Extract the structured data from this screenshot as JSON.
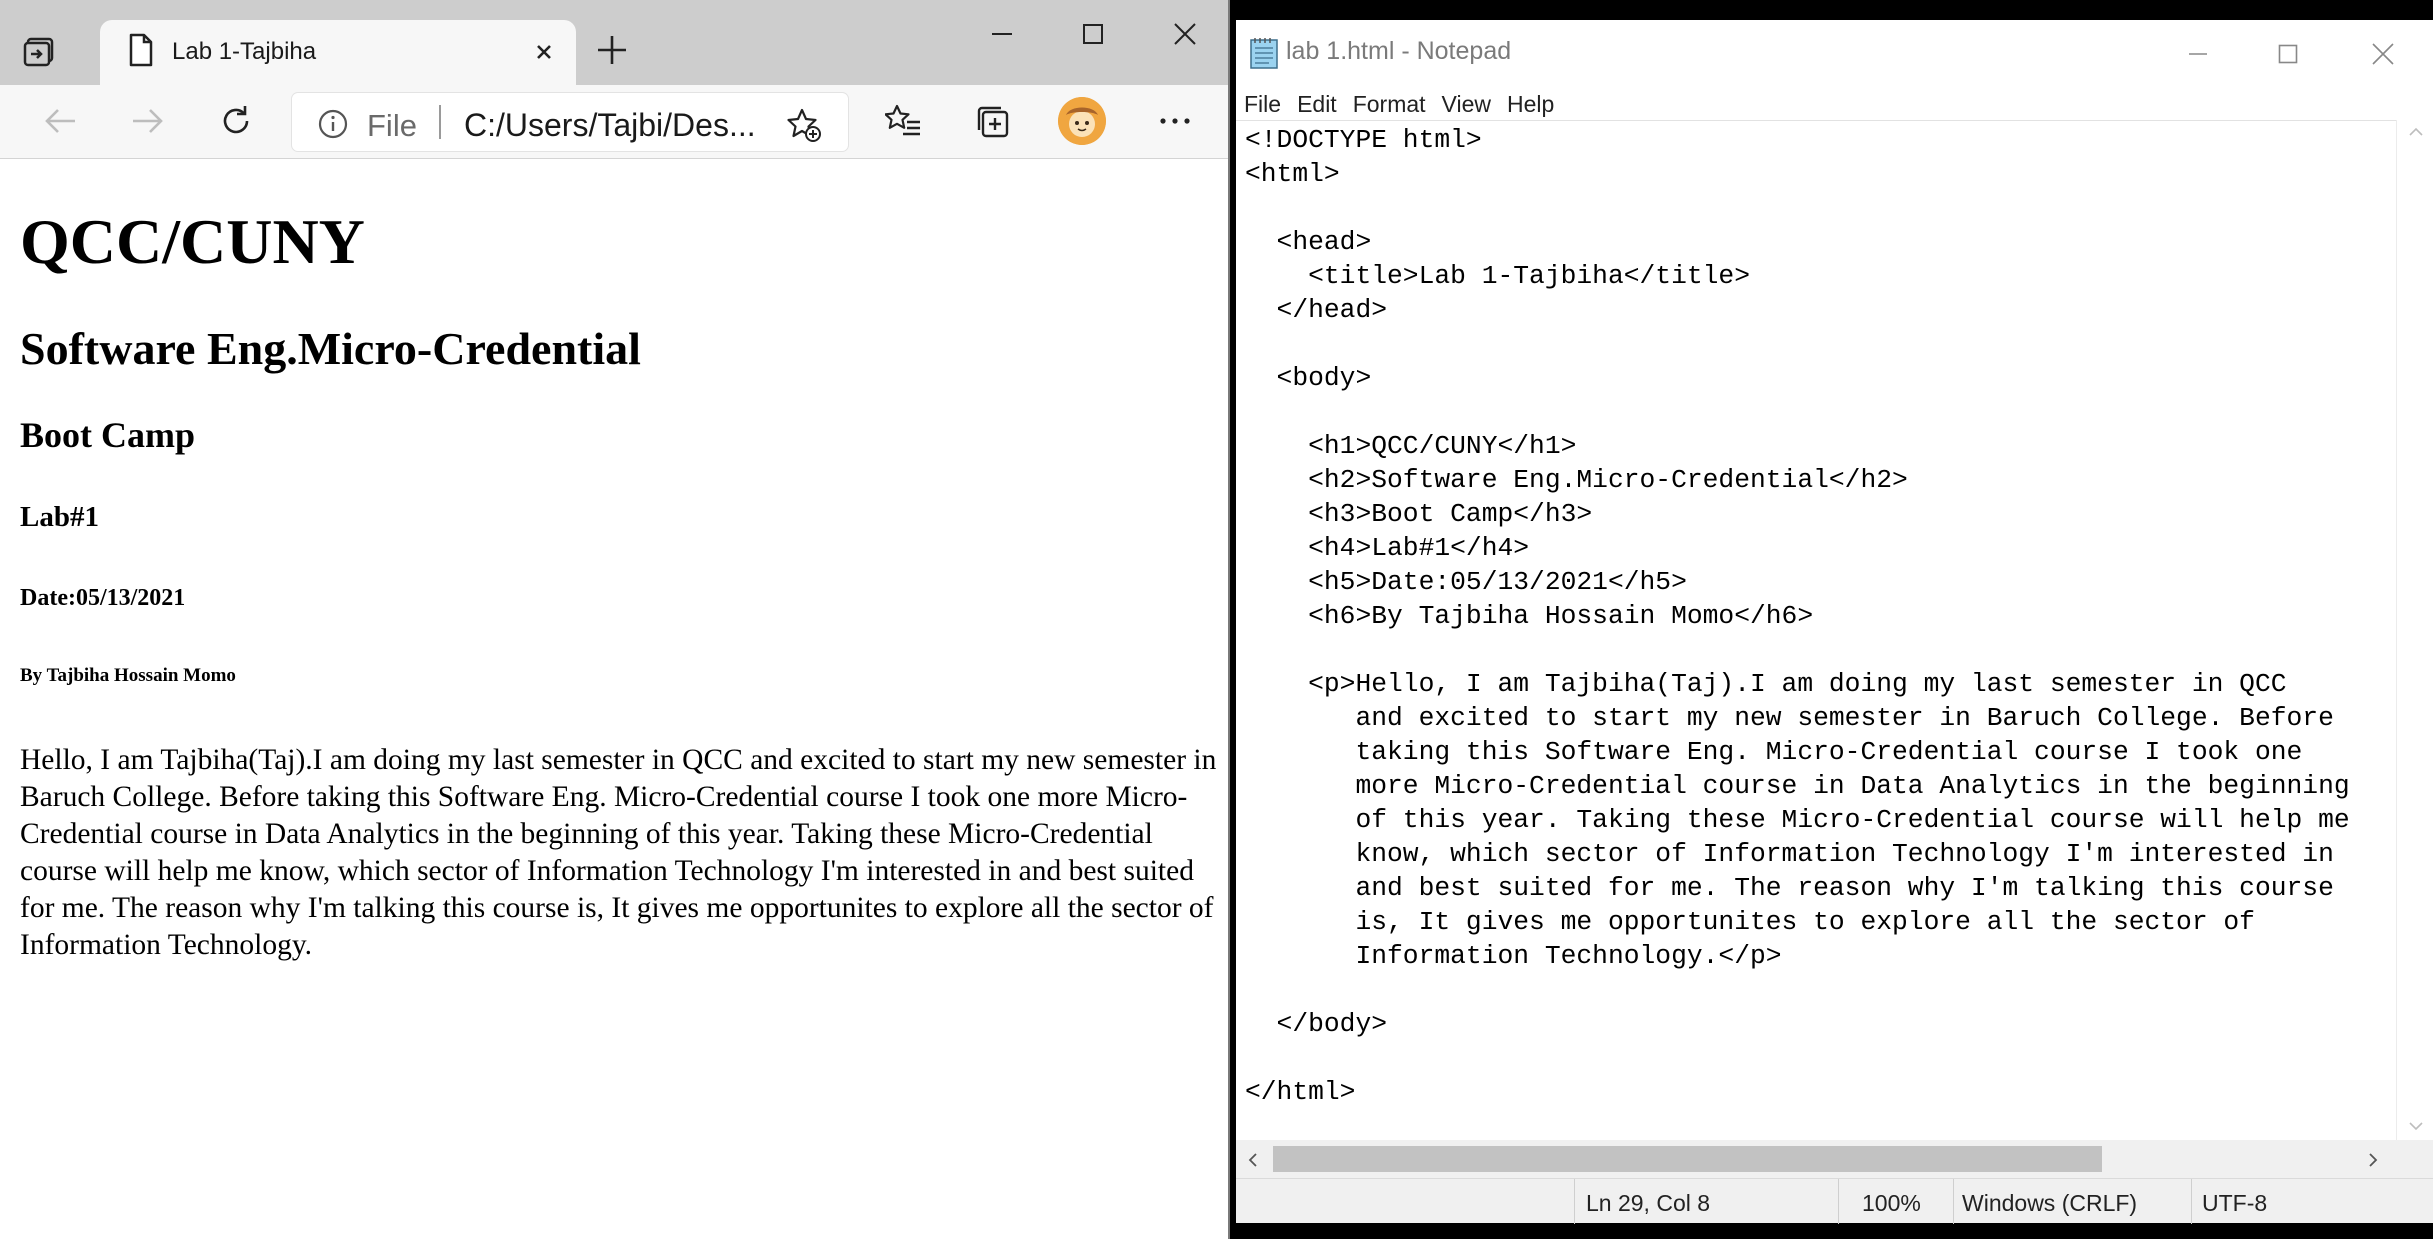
{
  "browser": {
    "tab_title": "Lab 1-Tajbiha",
    "address": {
      "scheme_label": "File",
      "url": "C:/Users/Tajbi/Des..."
    }
  },
  "document": {
    "h1": "QCC/CUNY",
    "h2": "Software Eng.Micro-Credential",
    "h3": "Boot Camp",
    "h4": "Lab#1",
    "h5": "Date:05/13/2021",
    "h6": "By Tajbiha Hossain Momo",
    "paragraph": "Hello, I am Tajbiha(Taj).I am doing my last semester in QCC and excited to start my new semester in Baruch College. Before taking this Software Eng. Micro-Credential course I took one more Micro-Credential course in Data Analytics in the beginning of this year. Taking these Micro-Credential course will help me know, which sector of Information Technology I'm interested in and best suited for me. The reason why I'm talking this course is, It gives me opportunites to explore all the sector of Information Technology."
  },
  "notepad": {
    "title": "lab 1.html - Notepad",
    "menu": [
      "File",
      "Edit",
      "Format",
      "View",
      "Help"
    ],
    "source": "<!DOCTYPE html>\n<html>\n\n  <head>\n    <title>Lab 1-Tajbiha</title>\n  </head>\n\n  <body>\n\n    <h1>QCC/CUNY</h1>\n    <h2>Software Eng.Micro-Credential</h2>\n    <h3>Boot Camp</h3>\n    <h4>Lab#1</h4>\n    <h5>Date:05/13/2021</h5>\n    <h6>By Tajbiha Hossain Momo</h6>\n\n    <p>Hello, I am Tajbiha(Taj).I am doing my last semester in QCC\n       and excited to start my new semester in Baruch College. Before\n       taking this Software Eng. Micro-Credential course I took one\n       more Micro-Credential course in Data Analytics in the beginning\n       of this year. Taking these Micro-Credential course will help me\n       know, which sector of Information Technology I'm interested in\n       and best suited for me. The reason why I'm talking this course\n       is, It gives me opportunites to explore all the sector of\n       Information Technology.</p>\n\n  </body>\n\n</html>",
    "status": {
      "position": "Ln 29, Col 8",
      "zoom": "100%",
      "line_endings": "Windows (CRLF)",
      "encoding": "UTF-8"
    }
  },
  "icons": {
    "tab_actions": "tab-actions-icon",
    "page": "page-icon",
    "close": "close-icon",
    "new_tab": "plus-icon",
    "back": "back-arrow-icon",
    "forward": "forward-arrow-icon",
    "refresh": "refresh-icon",
    "info": "info-icon",
    "add_favorite": "star-add-icon",
    "favorites": "favorites-list-icon",
    "collections": "collections-icon",
    "profile": "profile-avatar",
    "more": "more-dots-icon",
    "notepad": "notepad-icon"
  }
}
